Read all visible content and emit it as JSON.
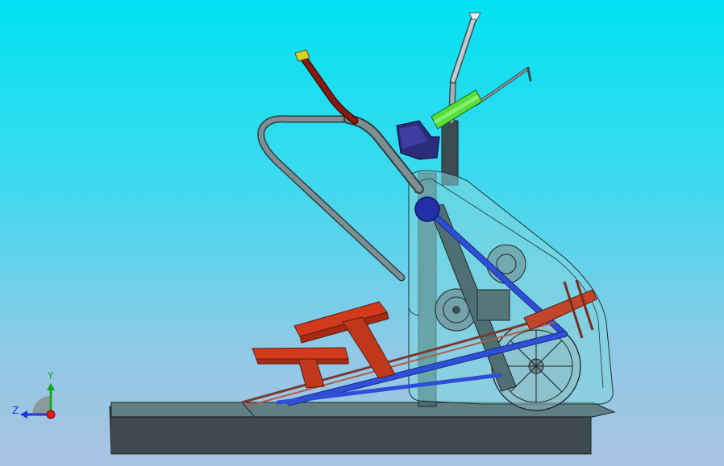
{
  "triad": {
    "x_label": "",
    "y_label": "Y",
    "z_label": "Z"
  },
  "colors": {
    "background_top": "#00e2f2",
    "background_bottom": "#aac3e2",
    "frame_steel": "#4f6f74",
    "glass_panel": "#7fd6dc",
    "blue_links": "#2e4fd8",
    "red_pedals": "#d23a1c",
    "brown_arm": "#8a1a10",
    "green_grip": "#57e03a",
    "navy_console": "#2b2c7a",
    "base_dark": "#3e4a4f",
    "axis_y": "#14a81e",
    "axis_z": "#2233dd",
    "origin": "#e01818"
  }
}
